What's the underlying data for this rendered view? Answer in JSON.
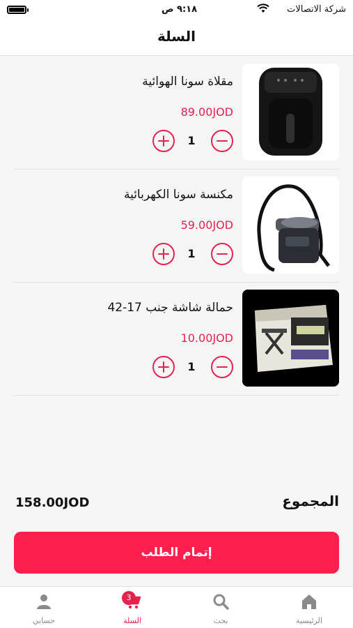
{
  "status_bar": {
    "carrier": "شركة الاتصالات",
    "time": "٩:١٨ ص"
  },
  "header": {
    "title": "السلة"
  },
  "cart": {
    "items": [
      {
        "name": "مقلاة سونا الهوائية",
        "price": "89.00JOD",
        "quantity": "1",
        "image_icon": "air-fryer-image"
      },
      {
        "name": "مكنسة سونا الكهربائية",
        "price": "59.00JOD",
        "quantity": "1",
        "image_icon": "vacuum-cleaner-image"
      },
      {
        "name": "حمالة شاشة جنب 17-42",
        "price": "10.00JOD",
        "quantity": "1",
        "image_icon": "tv-mount-box-image"
      }
    ]
  },
  "summary": {
    "total_label": "المجموع",
    "total_value": "158.00JOD",
    "checkout_label": "إتمام الطلب"
  },
  "bottom_nav": {
    "items": [
      {
        "label": "الرئيسية",
        "icon": "home-icon"
      },
      {
        "label": "بحث",
        "icon": "search-icon"
      },
      {
        "label": "السلة",
        "icon": "cart-icon",
        "badge": "3"
      },
      {
        "label": "حسابي",
        "icon": "account-icon"
      }
    ]
  },
  "colors": {
    "accent": "#e5224e",
    "button": "#ff1f4e",
    "background": "#f5f5f5"
  }
}
